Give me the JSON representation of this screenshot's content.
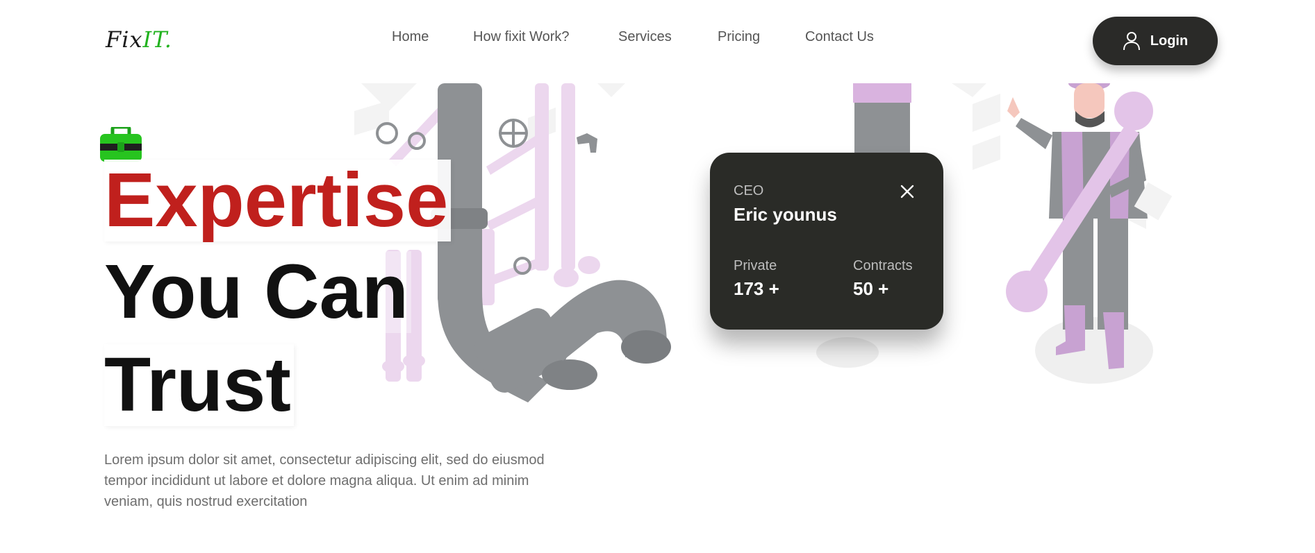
{
  "brand": {
    "logo_main": "Fix",
    "logo_accent": "IT."
  },
  "nav": {
    "items": [
      {
        "label": "Home"
      },
      {
        "label": "How fixit Work?"
      },
      {
        "label": "Services"
      },
      {
        "label": "Pricing"
      },
      {
        "label": "Contact Us"
      }
    ],
    "login_label": "Login"
  },
  "hero": {
    "headline_line1": "Expertise",
    "headline_line2": "You Can",
    "headline_line3": "Trust",
    "description": "Lorem ipsum dolor sit amet, consectetur adipiscing elit, sed do eiusmod tempor incididunt ut labore et dolore magna aliqua. Ut enim ad minim veniam, quis nostrud exercitation"
  },
  "ceo_card": {
    "role": "CEO",
    "name": "Eric younus",
    "stats": [
      {
        "label": "Private",
        "value": "173 +"
      },
      {
        "label": "Contracts",
        "value": "50 +"
      }
    ]
  },
  "colors": {
    "accent_red": "#c0201d",
    "logo_green": "#22b21f",
    "dark": "#2a2b27",
    "pipe_gray": "#8e9194",
    "pipe_lilac": "#e9d3ec"
  },
  "icons": [
    "toolbox-icon",
    "user-icon",
    "close-icon"
  ]
}
